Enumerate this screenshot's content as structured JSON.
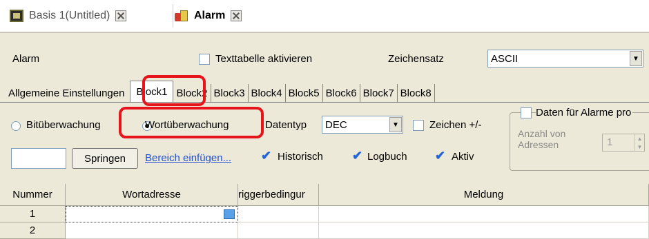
{
  "doc_tabs": [
    {
      "label": "Basis 1(Untitled)"
    },
    {
      "label": "Alarm"
    }
  ],
  "header": {
    "alarm_label": "Alarm",
    "texttabelle_label": "Texttabelle aktivieren",
    "zeichensatz_label": "Zeichensatz",
    "zeichensatz_value": "ASCII"
  },
  "tabs": [
    "Allgemeine Einstellungen",
    "Block1",
    "Block2",
    "Block3",
    "Block4",
    "Block5",
    "Block6",
    "Block7",
    "Block8"
  ],
  "options": {
    "bit_label": "Bitüberwachung",
    "wort_label": "Wortüberwachung",
    "datentyp_label": "Datentyp",
    "datentyp_value": "DEC",
    "zeichen_label": "Zeichen +/-",
    "daten_label": "Daten für Alarme pro",
    "anzahl_label_1": "Anzahl von",
    "anzahl_label_2": "Adressen",
    "anzahl_value": "1"
  },
  "actions": {
    "springen_label": "Springen",
    "bereich_label": "Bereich einfügen...",
    "historisch_label": "Historisch",
    "logbuch_label": "Logbuch",
    "aktiv_label": "Aktiv"
  },
  "grid": {
    "columns": [
      "Nummer",
      "Wortadresse",
      "riggerbedingur",
      "Meldung"
    ],
    "rows": [
      {
        "nummer": "1"
      },
      {
        "nummer": "2"
      }
    ]
  },
  "colors": {
    "highlight": "#e8141b",
    "link": "#1f4fd0",
    "check": "#2563d8"
  }
}
